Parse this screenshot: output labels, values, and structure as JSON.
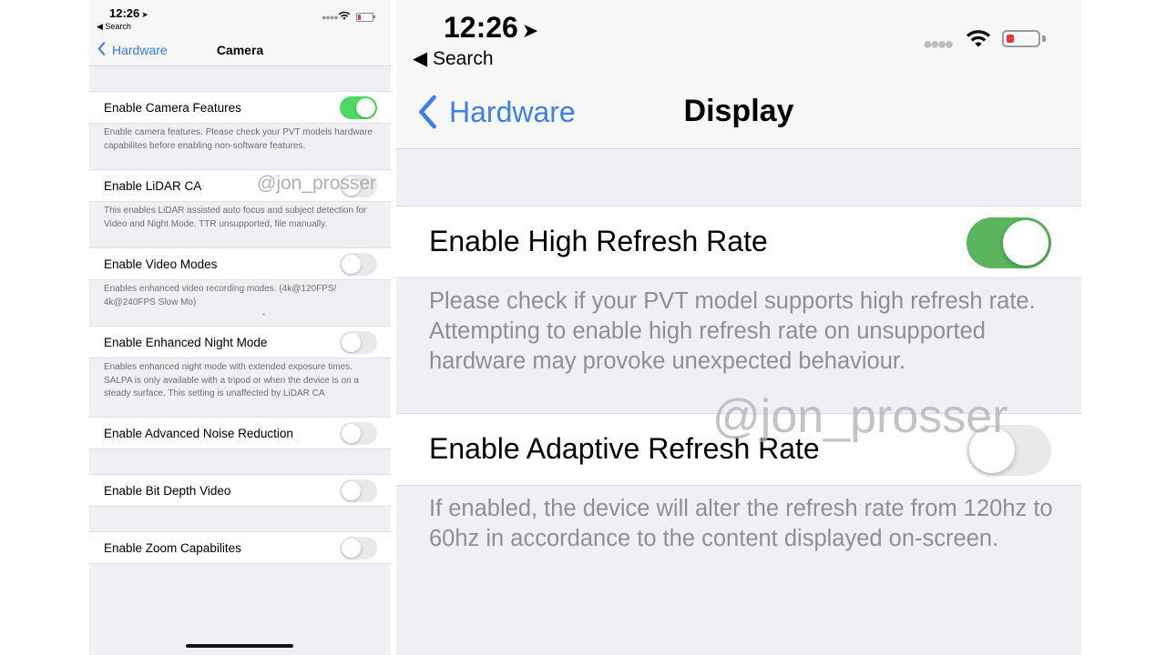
{
  "left_screen": {
    "status_bar": {
      "time": "12:26",
      "back_app": "Search"
    },
    "nav": {
      "back_label": "Hardware",
      "title": "Camera"
    },
    "rows": [
      {
        "label": "Enable Camera Features",
        "on": true,
        "footer": "Enable camera features. Please check your PVT models hardware capabilites before enabling non-software features."
      },
      {
        "label": "Enable LiDAR CA",
        "on": false,
        "footer": "This enables LiDAR assisted auto focus and subject detection for Video and Night Mode. TTR unsupported, file manually."
      },
      {
        "label": "Enable Video Modes",
        "on": false,
        "footer": "Enables enhanced video recording modes. (4k@120FPS/ 4k@240FPS Slow Mo)"
      },
      {
        "label": "Enable Enhanced Night Mode",
        "on": false,
        "footer": "Enables enhanced night mode with extended exposure times. SALPA is only available with a tripod or when the device is on a steady surface. This setting is unaffected by LiDAR CA"
      },
      {
        "label": "Enable Advanced Noise Reduction",
        "on": false
      },
      {
        "label": "Enable Bit Depth Video",
        "on": false
      },
      {
        "label": "Enable Zoom Capabilites",
        "on": false
      }
    ],
    "watermark": "@jon_prosser"
  },
  "right_screen": {
    "status_bar": {
      "time": "12:26",
      "back_app": "Search"
    },
    "nav": {
      "back_label": "Hardware",
      "title": "Display"
    },
    "rows": [
      {
        "label": "Enable High Refresh Rate",
        "on": true,
        "footer": "Please check if your PVT model supports high refresh rate. Attempting to enable high refresh rate on unsupported hardware may provoke unexpected behaviour."
      },
      {
        "label": "Enable Adaptive Refresh Rate",
        "on": false,
        "footer": "If enabled, the device will alter the refresh rate from 120hz to 60hz in accordance to the content displayed on-screen."
      }
    ],
    "watermark": "@jon_prosser"
  },
  "colors": {
    "toggle_on_left": "#4cd964",
    "toggle_on_right": "#5ab55e",
    "link_blue": "#2f7cf6",
    "battery_low": "#e53935"
  },
  "icons": {
    "location": "location-arrow-icon",
    "back": "chevron-left-icon",
    "signal": "signal-dots-icon",
    "wifi": "wifi-icon",
    "battery": "battery-icon"
  }
}
